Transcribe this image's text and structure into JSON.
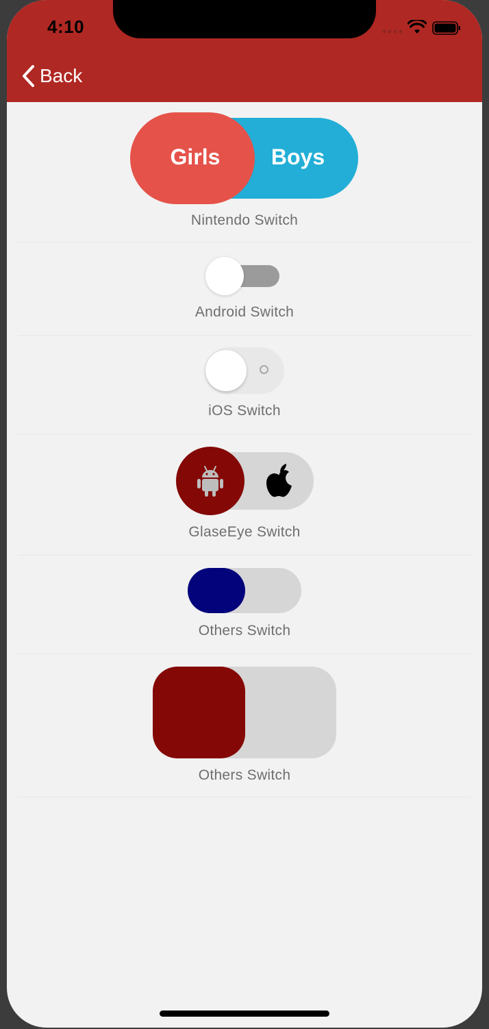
{
  "status_bar": {
    "time": "4:10",
    "icons": [
      "signal-icon",
      "wifi-icon",
      "battery-icon"
    ]
  },
  "nav": {
    "back_label": "Back",
    "back_icon": "chevron-left-icon",
    "bar_color": "#b02823"
  },
  "switches": [
    {
      "name": "Nintendo Switch",
      "left_label": "Girls",
      "right_label": "Boys",
      "selected": "Girls",
      "knob_color": "#e5524a",
      "track_color": "#22aed6"
    },
    {
      "name": "Android Switch",
      "on": false,
      "track_color": "#9b9b9b"
    },
    {
      "name": "iOS Switch",
      "on": false,
      "track_color": "#e8e8e8"
    },
    {
      "name": "GlaseEye Switch",
      "selected_icon": "android-icon",
      "other_icon": "apple-icon",
      "knob_color": "#840806"
    },
    {
      "name": "Others Switch",
      "on": false,
      "knob_color": "#03047c"
    },
    {
      "name": "Others Switch",
      "on": false,
      "knob_color": "#840806"
    }
  ]
}
